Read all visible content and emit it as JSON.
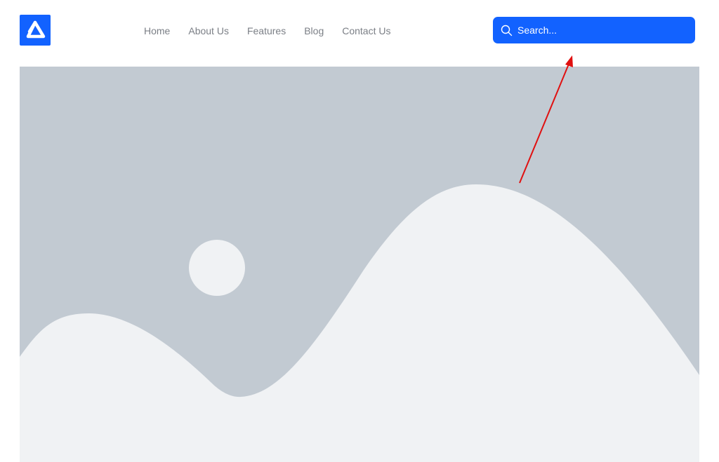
{
  "brand": {
    "logo_icon": "triangle-logo-icon",
    "color": "#1262ff"
  },
  "nav": {
    "items": [
      {
        "label": "Home"
      },
      {
        "label": "About Us"
      },
      {
        "label": "Features"
      },
      {
        "label": "Blog"
      },
      {
        "label": "Contact Us"
      }
    ]
  },
  "search": {
    "placeholder": "Search...",
    "icon": "search-icon",
    "background": "#1262ff"
  },
  "hero": {
    "image_type": "placeholder-image",
    "icons": [
      "sun-icon",
      "mountains-icon"
    ],
    "sky_color": "#c2cad2",
    "land_color": "#f0f2f4"
  },
  "annotation": {
    "icon": "arrow-icon",
    "color": "#e01010"
  }
}
